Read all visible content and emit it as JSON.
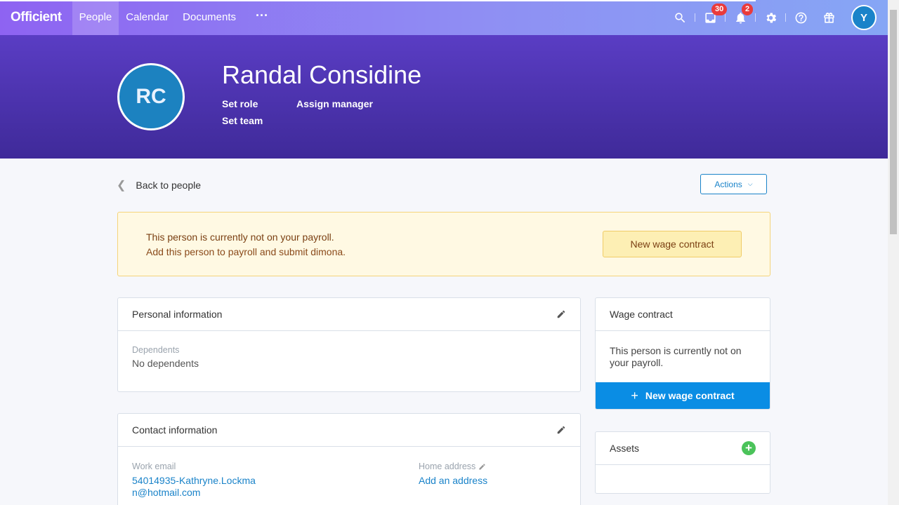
{
  "nav": {
    "logo": "Officient",
    "items": [
      {
        "label": "People"
      },
      {
        "label": "Calendar"
      },
      {
        "label": "Documents"
      }
    ],
    "more": "···",
    "inbox_count": "30",
    "notifications_count": "2",
    "user_initial": "Y"
  },
  "profile": {
    "initials": "RC",
    "name": "Randal Considine",
    "set_role": "Set role",
    "assign_manager": "Assign manager",
    "set_team": "Set team"
  },
  "toolbar": {
    "back": "Back to people",
    "actions": "Actions"
  },
  "alert": {
    "title": "This person is currently not on your payroll.",
    "subtitle": "Add this person to payroll and submit dimona.",
    "button": "New wage contract"
  },
  "personal": {
    "title": "Personal information",
    "dependents_label": "Dependents",
    "dependents_value": "No dependents"
  },
  "contact": {
    "title": "Contact information",
    "work_email_label": "Work email",
    "work_email_line1": "54014935-Kathryne.Lockma",
    "work_email_line2": "n@hotmail.com",
    "home_address_label": "Home address",
    "home_address_action": "Add an address"
  },
  "wage": {
    "title": "Wage contract",
    "text_line1": "This person is currently not on",
    "text_line2": "your payroll.",
    "button": "New wage contract"
  },
  "assets": {
    "title": "Assets"
  },
  "icons": [
    "search-icon",
    "inbox-icon",
    "bell-icon",
    "gear-icon",
    "help-icon",
    "gift-icon",
    "pencil-icon",
    "plus-icon",
    "chevron-left-icon",
    "chevron-down-icon"
  ],
  "colors": {
    "accent": "#1a83c9",
    "primary_button": "#0a8de4",
    "header": "#4a32ad"
  }
}
